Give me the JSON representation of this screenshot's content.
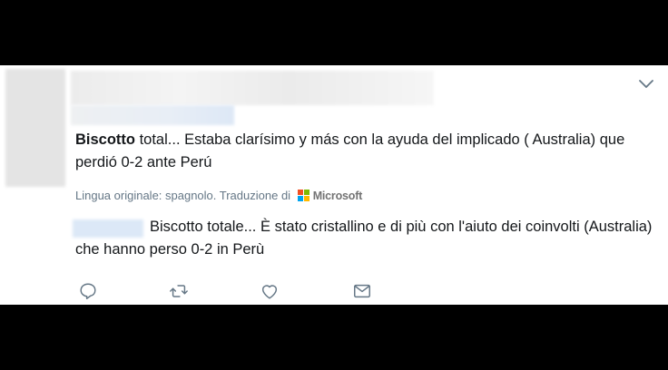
{
  "tweet": {
    "text_bold": "Biscotto",
    "text_rest": " total... Estaba clarísimo y más con la ayuda del implicado ( Australia) que perdió 0-2 ante Perú"
  },
  "translation": {
    "label": "Lingua originale: spagnolo. Traduzione di",
    "provider": "Microsoft",
    "text": "Biscotto totale... È stato cristallino e di più con l'aiuto dei coinvolti (Australia) che hanno perso 0-2 in Perù"
  },
  "icons": {
    "chevron": "chevron-down-icon",
    "reply": "reply-icon",
    "retweet": "retweet-icon",
    "like": "heart-icon",
    "dm": "envelope-icon"
  },
  "colors": {
    "text": "#14171a",
    "muted": "#657786",
    "icon": "#657786"
  }
}
